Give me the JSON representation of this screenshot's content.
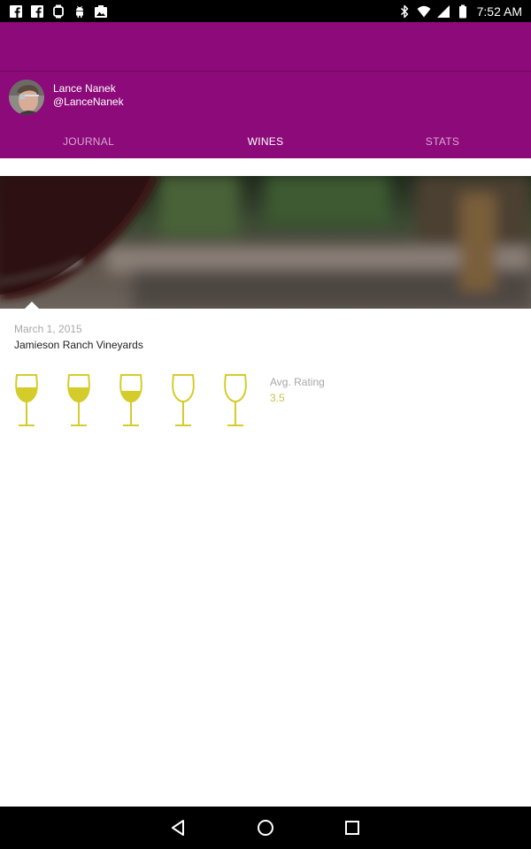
{
  "status_bar": {
    "time": "7:52 AM",
    "left_icons": [
      "facebook-icon",
      "facebook-icon",
      "android-wear-icon",
      "android-icon",
      "photo-icon"
    ],
    "right_icons": [
      "bluetooth-icon",
      "wifi-icon",
      "cellular-signal-icon",
      "battery-icon"
    ]
  },
  "profile": {
    "name": "Lance Nanek",
    "handle": "@LanceNanek"
  },
  "tabs": [
    {
      "label": "JOURNAL",
      "active": false
    },
    {
      "label": "WINES",
      "active": true
    },
    {
      "label": "STATS",
      "active": false
    }
  ],
  "entry": {
    "date": "March 1, 2015",
    "title": "Jamieson Ranch Vineyards",
    "glass_fill_levels": [
      1,
      1,
      1,
      0,
      0
    ],
    "avg_label": "Avg. Rating",
    "avg_value": "3.5"
  },
  "colors": {
    "primary": "#8c0a79",
    "rating_accent": "#d4cc2a"
  }
}
